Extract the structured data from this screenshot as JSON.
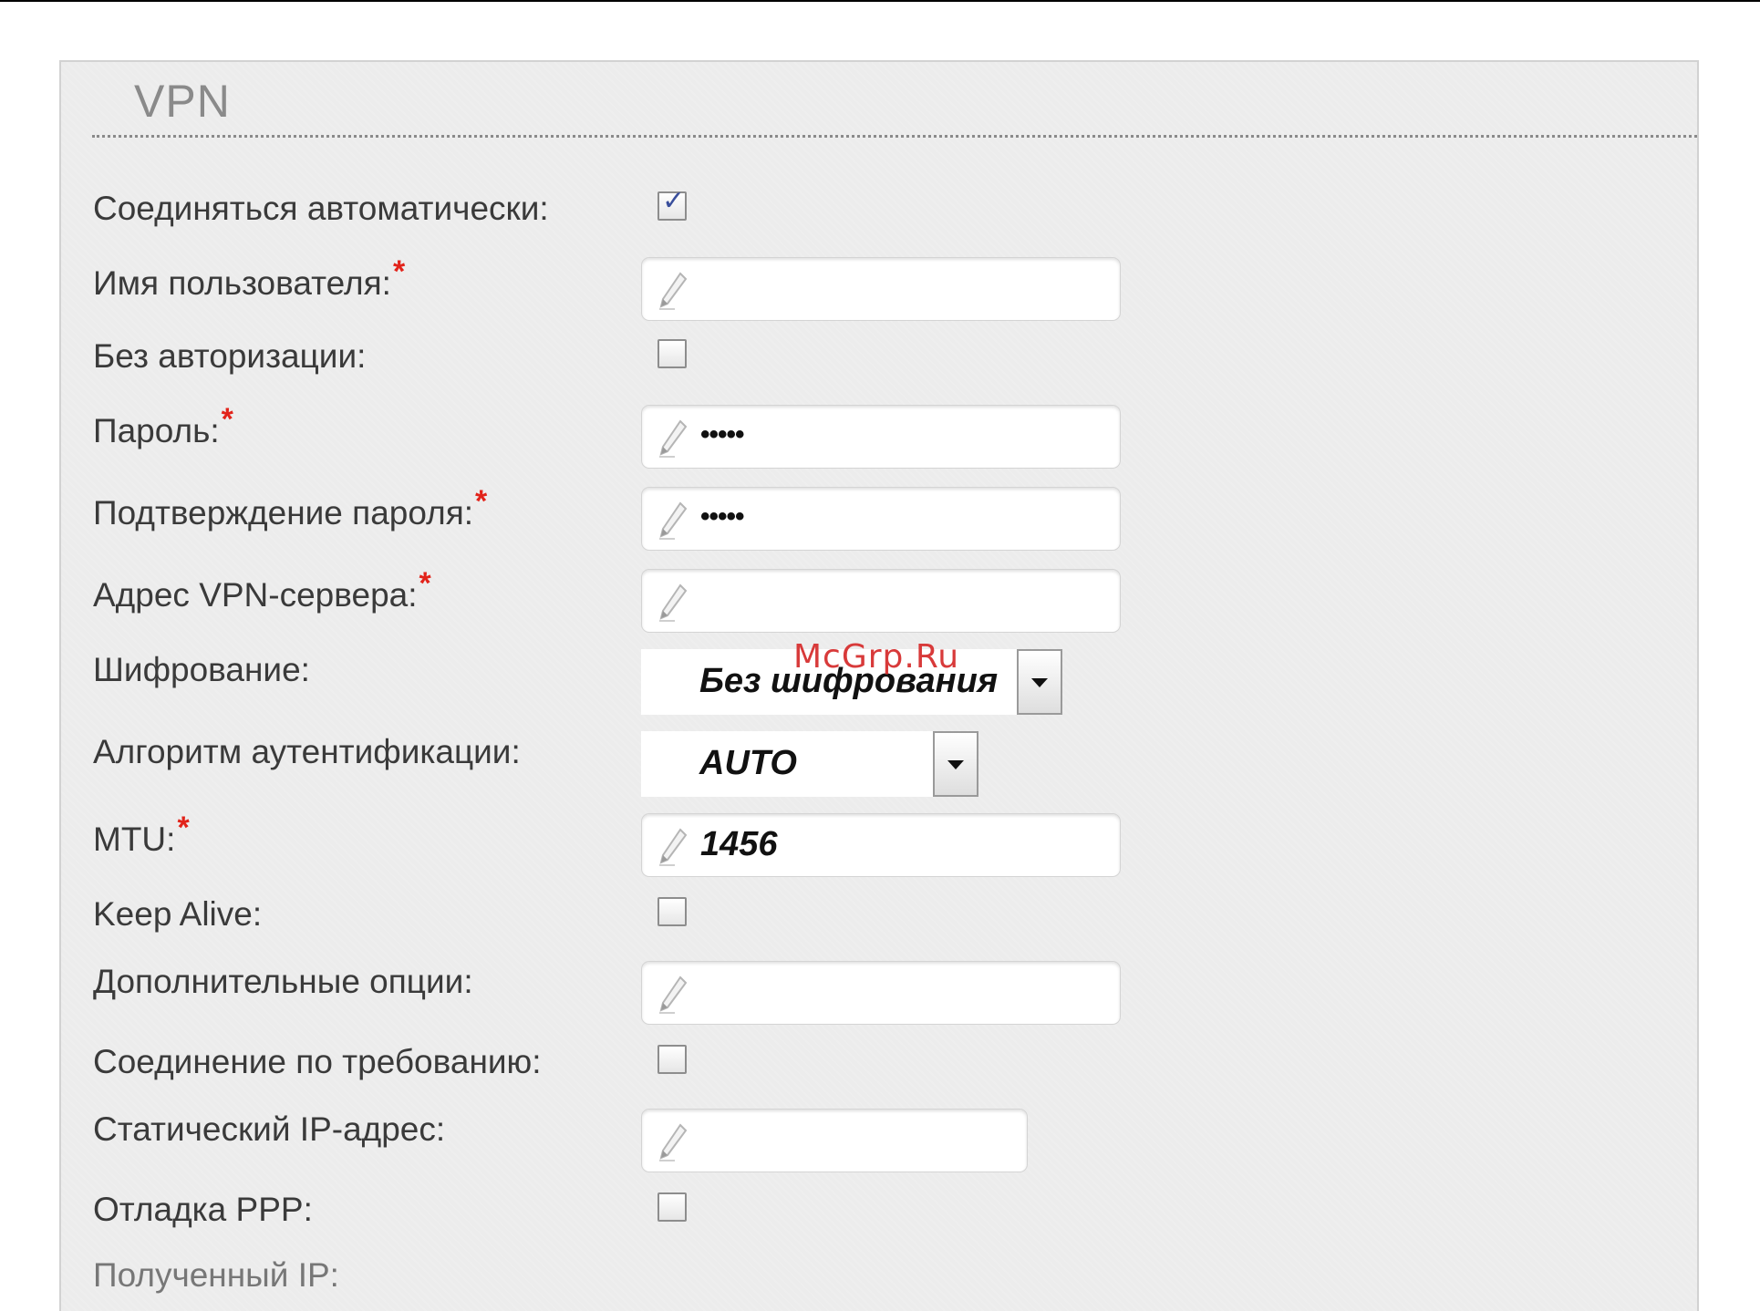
{
  "panel": {
    "title": "VPN"
  },
  "fields": {
    "connect_auto": {
      "label": "Соединяться автоматически:",
      "checked": true
    },
    "username": {
      "label": "Имя пользователя:",
      "required": "*",
      "value": ""
    },
    "no_auth": {
      "label": "Без авторизации:",
      "checked": false
    },
    "password": {
      "label": "Пароль:",
      "required": "*",
      "value": "•••••"
    },
    "password_confirm": {
      "label": "Подтверждение пароля:",
      "required": "*",
      "value": "•••••"
    },
    "vpn_server": {
      "label": "Адрес VPN-сервера:",
      "required": "*",
      "value": ""
    },
    "encryption": {
      "label": "Шифрование:",
      "value": "Без шифрования"
    },
    "auth_algorithm": {
      "label": "Алгоритм аутентификации:",
      "value": "AUTO"
    },
    "mtu": {
      "label": "MTU:",
      "required": "*",
      "value": "1456"
    },
    "keep_alive": {
      "label": "Keep Alive:",
      "checked": false
    },
    "extra_options": {
      "label": "Дополнительные опции:",
      "value": ""
    },
    "on_demand": {
      "label": "Соединение по требованию:",
      "checked": false
    },
    "static_ip": {
      "label": "Статический IP-адрес:",
      "value": ""
    },
    "ppp_debug": {
      "label": "Отладка PPP:",
      "checked": false
    },
    "received_ip": {
      "label": "Полученный IP:"
    }
  },
  "watermark": "McGrp.Ru",
  "colors": {
    "panel_bg": "#ececec",
    "required": "#e2231a",
    "check": "#3a4f9c",
    "watermark": "#d83a3a"
  }
}
